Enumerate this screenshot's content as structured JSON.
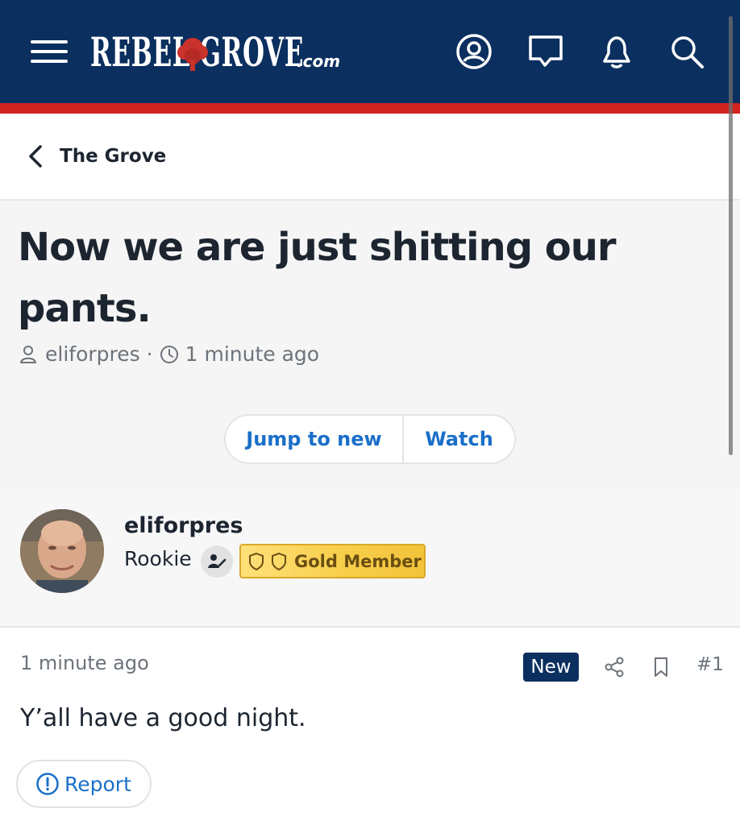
{
  "header": {
    "logo_text": "REBEL GROVE",
    "logo_suffix": ".com",
    "icons": [
      "menu-icon",
      "account-icon",
      "conversations-icon",
      "alerts-icon",
      "search-icon"
    ],
    "colors": {
      "bar": "#0b2f5f",
      "accent_stripe": "#d2231f"
    }
  },
  "breadcrumb": {
    "label": "The Grove",
    "icon": "chevron-left-icon"
  },
  "thread": {
    "title": "Now we are just shitting our pants.",
    "author": "eliforpres",
    "separator": "·",
    "time": "1 minute ago",
    "actions": {
      "jump": "Jump to new",
      "watch": "Watch"
    }
  },
  "author_card": {
    "name": "eliforpres",
    "title": "Rookie",
    "badge": "Gold Member",
    "badge_color": "#f8cf4b"
  },
  "post": {
    "time": "1 minute ago",
    "new_badge": "New",
    "number": "#1",
    "body": "Y’all have a good night.",
    "report_label": "Report"
  }
}
